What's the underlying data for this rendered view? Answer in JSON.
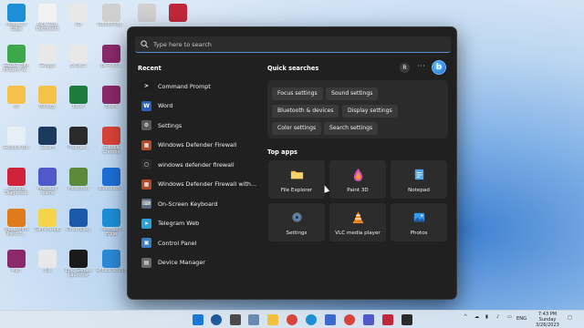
{
  "search": {
    "placeholder": "Type here to search"
  },
  "recent": {
    "title": "Recent",
    "items": [
      {
        "label": "Command Prompt",
        "icon": "command-prompt-icon",
        "color": "#1e1e1e",
        "glyph": ">"
      },
      {
        "label": "Word",
        "icon": "word-icon",
        "color": "#2b5fb8",
        "glyph": "W"
      },
      {
        "label": "Settings",
        "icon": "settings-gear-icon",
        "color": "#5a5a5a",
        "glyph": "⚙"
      },
      {
        "label": "Windows Defender Firewall",
        "icon": "firewall-icon",
        "color": "#b04a2a",
        "glyph": "▦"
      },
      {
        "label": "windows defender firewall",
        "icon": "search-icon",
        "color": "#2b2b2b",
        "glyph": "○"
      },
      {
        "label": "Windows Defender Firewall with...",
        "icon": "firewall-icon",
        "color": "#b04a2a",
        "glyph": "▦"
      },
      {
        "label": "On-Screen Keyboard",
        "icon": "keyboard-icon",
        "color": "#5a6e80",
        "glyph": "⌨"
      },
      {
        "label": "Telegram Web",
        "icon": "telegram-icon",
        "color": "#2aa1da",
        "glyph": "➤"
      },
      {
        "label": "Control Panel",
        "icon": "control-panel-icon",
        "color": "#3a7fc0",
        "glyph": "▣"
      },
      {
        "label": "Device Manager",
        "icon": "device-manager-icon",
        "color": "#6a6a6a",
        "glyph": "▤"
      }
    ]
  },
  "quick_searches": {
    "title": "Quick searches",
    "avatar": "R",
    "more": "···",
    "bing": "b",
    "chips": [
      "Focus settings",
      "Sound settings",
      "Bluetooth & devices",
      "Display settings",
      "Color settings",
      "Search settings"
    ]
  },
  "top_apps": {
    "title": "Top apps",
    "apps": [
      {
        "label": "File Explorer",
        "icon": "folder-icon"
      },
      {
        "label": "Paint 3D",
        "icon": "paint3d-icon"
      },
      {
        "label": "Notepad",
        "icon": "notepad-icon"
      },
      {
        "label": "Settings",
        "icon": "gear-icon"
      },
      {
        "label": "VLC media player",
        "icon": "vlc-icon"
      },
      {
        "label": "Photos",
        "icon": "photos-icon"
      }
    ]
  },
  "desktop": {
    "icons": [
      {
        "label": "Microsoft Edge",
        "color": "#1c8fd6"
      },
      {
        "label": "New Text Document",
        "color": "#f2f2f2"
      },
      {
        "label": "Rb",
        "color": "#e8e8e8"
      },
      {
        "label": "RobloxPlay...",
        "color": "#cfcfcf"
      },
      {
        "label": "",
        "color": "#d0d0d0"
      },
      {
        "label": "",
        "color": "#c2263a"
      },
      {
        "label": "GLORY Bay Modern W...",
        "color": "#3da84a"
      },
      {
        "label": "Glogge",
        "color": "#e8e8e8"
      },
      {
        "label": "project",
        "color": "#e8e8e8"
      },
      {
        "label": "pk-R_rx...",
        "color": "#8a2a6a"
      },
      {
        "label": "ex",
        "color": "#f4c24a"
      },
      {
        "label": "Biology",
        "color": "#f4c24a"
      },
      {
        "label": "Excel",
        "color": "#1f7a40"
      },
      {
        "label": "Exam",
        "color": "#8a2a6a"
      },
      {
        "label": "Recycle Bin",
        "color": "#e6eef6"
      },
      {
        "label": "Steam",
        "color": "#1b3a5e"
      },
      {
        "label": "Thunder...",
        "color": "#2a2a2a"
      },
      {
        "label": "Google Chrome",
        "color": "#d8433a"
      },
      {
        "label": "Lenovo Diagnostic",
        "color": "#d0223a"
      },
      {
        "label": "Microsoft Teams",
        "color": "#5059c9"
      },
      {
        "label": "Minecraft",
        "color": "#5a8a3a"
      },
      {
        "label": "Bluetooth...",
        "color": "#1c6fd6"
      },
      {
        "label": "NeverMind Paint 3...",
        "color": "#e07a1a"
      },
      {
        "label": "CameraApp",
        "color": "#f4d44a"
      },
      {
        "label": "DriverEasy",
        "color": "#1a5aa8"
      },
      {
        "label": "Microsoft Edge",
        "color": "#1c8fd6"
      },
      {
        "label": "Marr",
        "color": "#8a2a6a"
      },
      {
        "label": "file",
        "color": "#e8e8e8"
      },
      {
        "label": "Epic Games Launcher",
        "color": "#1a1a1a"
      },
      {
        "label": "Roblox Studio",
        "color": "#2a8ad6"
      }
    ]
  },
  "taskbar": {
    "apps": [
      "start",
      "search",
      "task-view",
      "widgets",
      "explorer",
      "chrome",
      "edge",
      "store",
      "app",
      "chrome2",
      "app2",
      "app3",
      "app4"
    ],
    "tray": {
      "lang": "ENG",
      "time": "7:43 PM",
      "day": "Sunday",
      "date": "3/26/2023"
    }
  }
}
